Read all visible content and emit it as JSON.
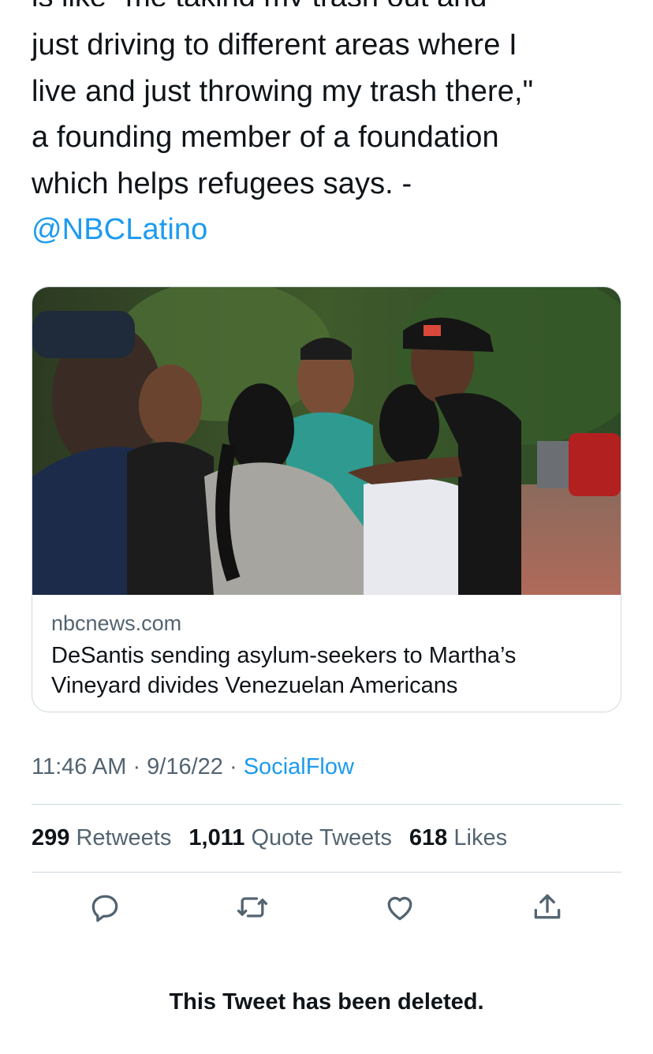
{
  "tweet": {
    "cut_line": "is like \"me taking my trash out and",
    "lines": [
      "just driving to different areas where I",
      "live and just throwing my trash there,\"",
      "a founding member of a foundation",
      "which helps refugees says. -"
    ],
    "mention": "@NBCLatino"
  },
  "card": {
    "domain": "nbcnews.com",
    "title_line1": "DeSantis sending asylum-seekers to Martha’s",
    "title_line2": "Vineyard divides Venezuelan Americans",
    "image_icon": "news-photo"
  },
  "meta": {
    "time": "11:46 AM",
    "sep1": " · ",
    "date": "9/16/22",
    "sep2": " · ",
    "source": "SocialFlow"
  },
  "stats": {
    "retweets_count": "299",
    "retweets_label": "Retweets",
    "quotes_count": "1,011",
    "quotes_label": "Quote Tweets",
    "likes_count": "618",
    "likes_label": "Likes"
  },
  "actions": [
    {
      "icon": "reply-icon"
    },
    {
      "icon": "retweet-icon"
    },
    {
      "icon": "like-icon"
    },
    {
      "icon": "share-icon"
    }
  ],
  "colors": {
    "link": "#1d9bf0",
    "secondary_text": "#536471",
    "border": "#cfd9de"
  },
  "deleted_notice": "This Tweet has been deleted."
}
